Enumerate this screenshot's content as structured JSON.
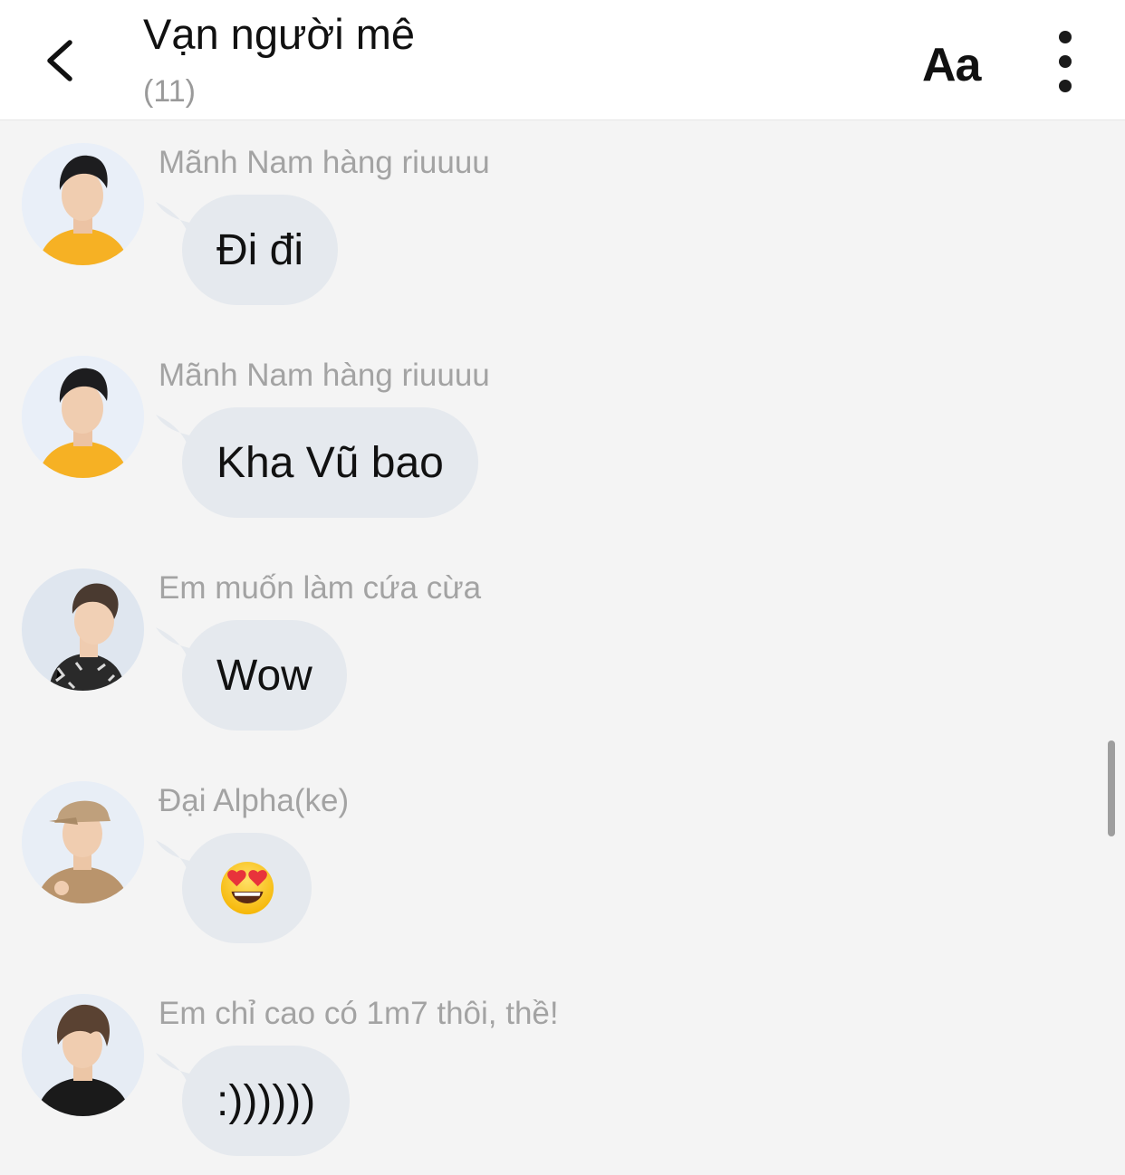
{
  "header": {
    "title": "Vạn người mê",
    "member_count": "(11)",
    "font_button_label": "Aa",
    "back_icon": "chevron-left-icon",
    "menu_icon": "more-vertical-icon"
  },
  "messages": [
    {
      "sender": "Mãnh Nam hàng riuuuu",
      "text": "Đi đi"
    },
    {
      "sender": "Mãnh Nam hàng riuuuu",
      "text": "Kha Vũ bao"
    },
    {
      "sender": "Em muốn làm cứa cừa",
      "text": "Wow"
    },
    {
      "sender": "Đại Alpha(ke)",
      "text": "",
      "emoji": "heart-eyes-emoji"
    },
    {
      "sender": "Em chỉ cao có 1m7 thôi, thề!",
      "text": ":))))))"
    }
  ],
  "colors": {
    "background": "#f4f4f4",
    "header": "#ffffff",
    "bubble": "#e5e9ee",
    "sender_text": "#a3a3a3"
  }
}
